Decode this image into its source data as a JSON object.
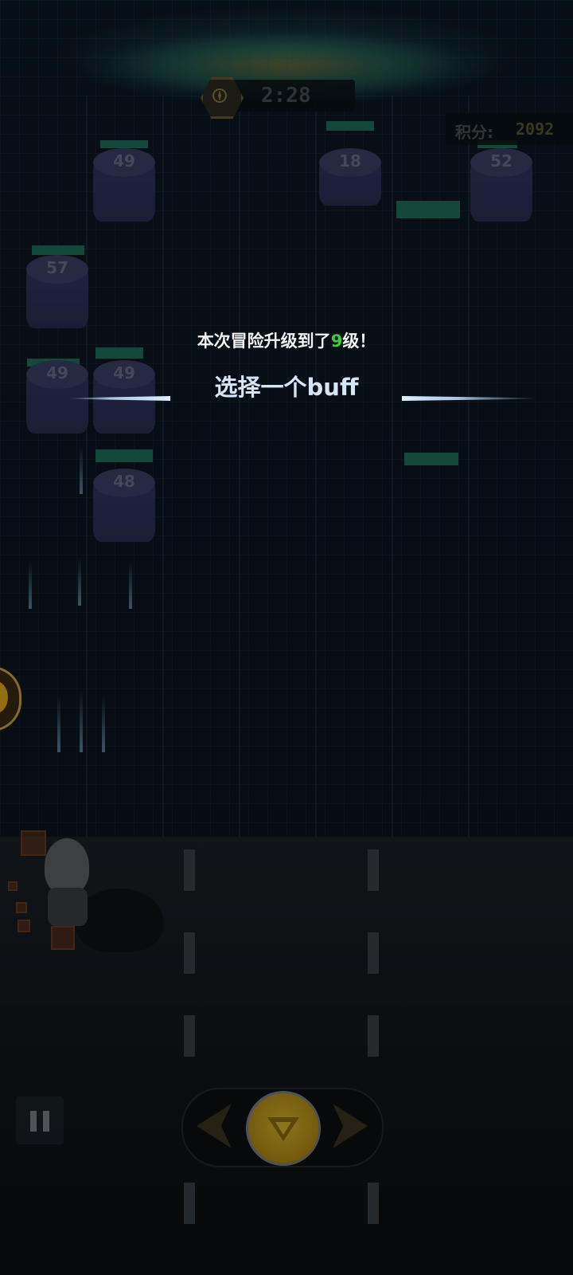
{
  "hud": {
    "timer": "2:28",
    "score_label": "积分:",
    "score_value": "2092"
  },
  "blocks": [
    {
      "value": "49"
    },
    {
      "value": "18"
    },
    {
      "value": "52"
    },
    {
      "value": "57"
    },
    {
      "value": "49"
    },
    {
      "value": "49"
    },
    {
      "value": "48"
    }
  ],
  "levelup": {
    "msg_prefix": "本次冒险升级到了",
    "level": "9",
    "msg_suffix": "级！",
    "buff_title": "选择一个buff"
  },
  "colors": {
    "level_highlight": "#3ecb3e",
    "buff_title": "#d7e6f7",
    "fire_button": "#d8b32c"
  },
  "icons": {
    "timer": "compass-icon",
    "pause": "pause-icon",
    "fire": "fire-emblem-icon",
    "move_left": "arrow-left-icon",
    "move_right": "arrow-right-icon",
    "side_skill": "skill-badge-icon"
  }
}
